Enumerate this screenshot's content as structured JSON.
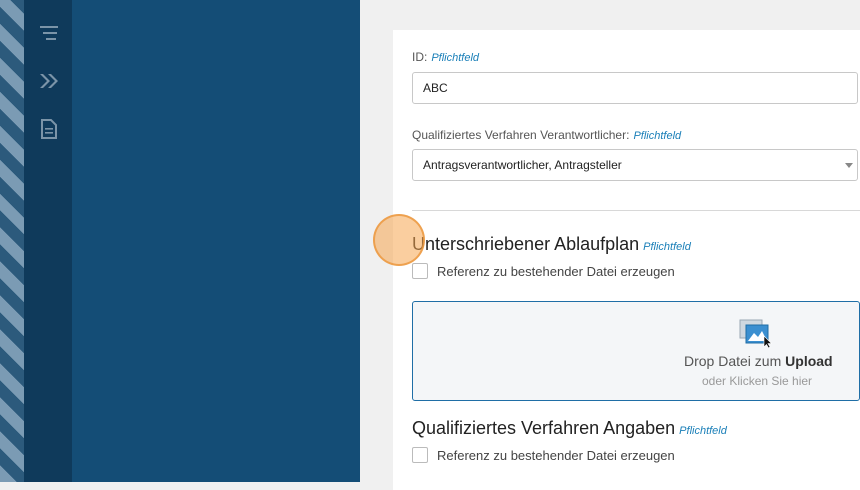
{
  "sidebar": {
    "icons": [
      "filter-icon",
      "forward-icon",
      "document-icon"
    ]
  },
  "form": {
    "id_field": {
      "label": "ID:",
      "required": "Pflichtfeld",
      "value": "ABC"
    },
    "responsible_field": {
      "label": "Qualifiziertes Verfahren Verantwortlicher:",
      "required": "Pflichtfeld",
      "value": "Antragsverantwortlicher, Antragsteller"
    },
    "section_signed_plan": {
      "title": "Unterschriebener Ablaufplan",
      "required": "Pflichtfeld",
      "checkbox_label": "Referenz zu bestehender Datei erzeugen",
      "dropzone": {
        "text_prefix": "Drop Datei zum",
        "text_bold": "Upload",
        "subtext": "oder Klicken Sie hier"
      }
    },
    "section_details": {
      "title": "Qualifiziertes Verfahren Angaben",
      "required": "Pflichtfeld",
      "checkbox_label": "Referenz zu bestehender Datei erzeugen"
    }
  },
  "colors": {
    "rail": "#0f3a5b",
    "panel": "#144d76",
    "accent": "#1a7fb8"
  }
}
